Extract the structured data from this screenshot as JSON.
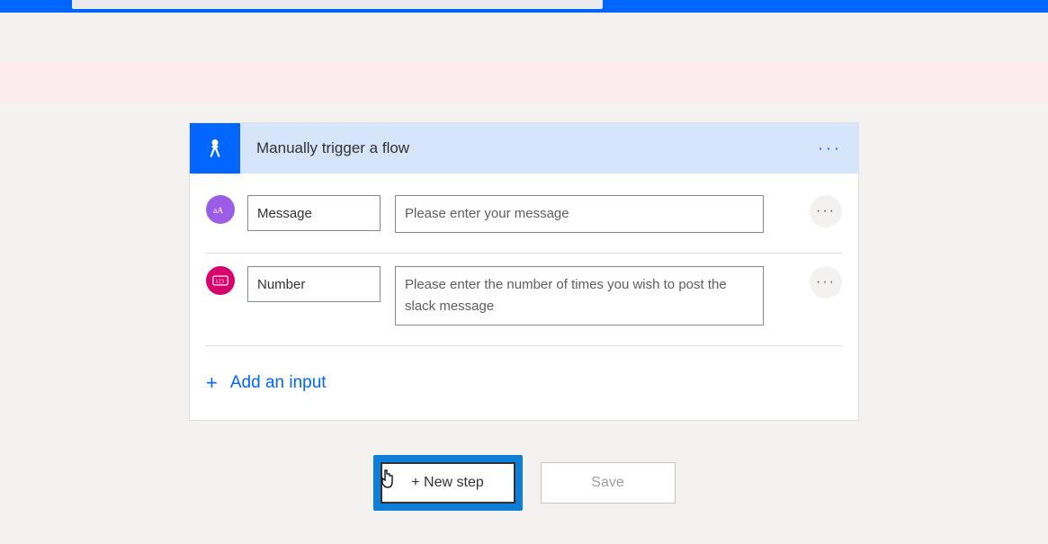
{
  "header": {
    "title": "Manually trigger a flow"
  },
  "inputs": [
    {
      "name": "Message",
      "prompt": "Please enter your message",
      "type": "text"
    },
    {
      "name": "Number",
      "prompt": "Please enter the number of times you wish to post the slack message",
      "type": "number"
    }
  ],
  "actions": {
    "add_input": "Add an input",
    "new_step": "+ New step",
    "save": "Save"
  },
  "icons": {
    "more": "···"
  }
}
